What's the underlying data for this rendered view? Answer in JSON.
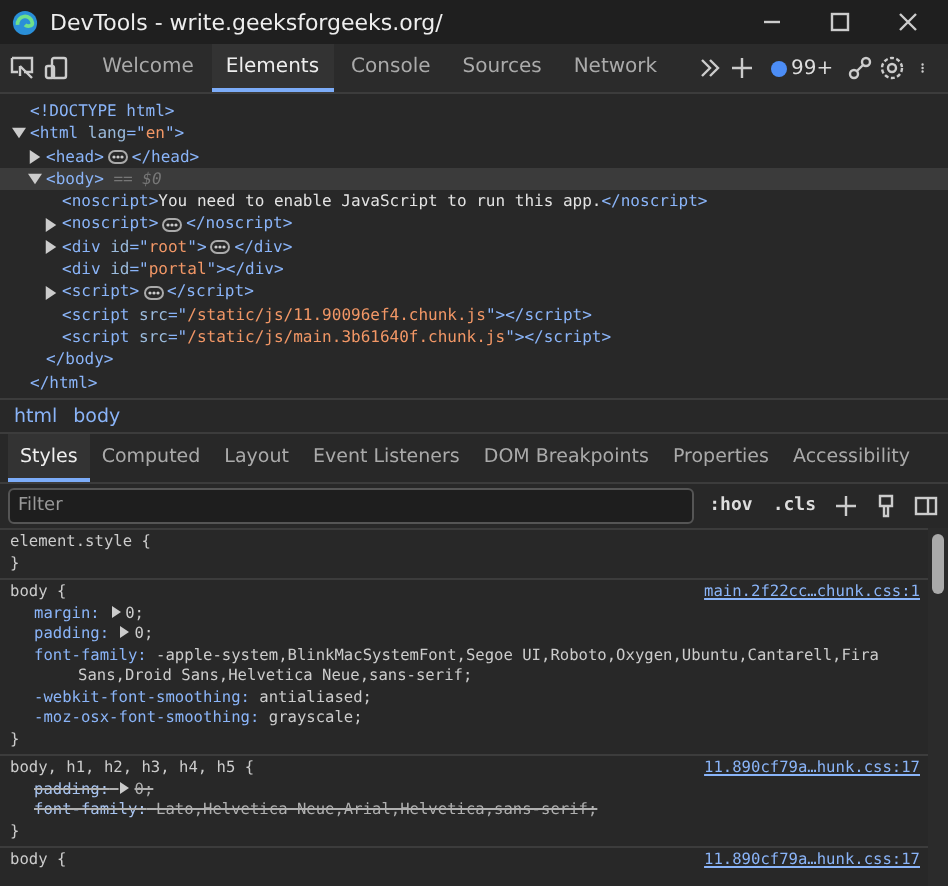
{
  "window": {
    "title": "DevTools - write.geeksforgeeks.org/"
  },
  "toolbar": {
    "tabs": [
      {
        "label": "Welcome",
        "selected": false
      },
      {
        "label": "Elements",
        "selected": true
      },
      {
        "label": "Console",
        "selected": false
      },
      {
        "label": "Sources",
        "selected": false
      },
      {
        "label": "Network",
        "selected": false
      }
    ],
    "issues_badge": "99+"
  },
  "dom_tree": [
    {
      "kind": "leaf",
      "tokens": [
        {
          "kind": "tag",
          "s": "<!DOCTYPE html>"
        }
      ]
    },
    {
      "kind": "open",
      "expanded": true,
      "selected": false,
      "tokens": [
        {
          "kind": "tag",
          "s": "<html"
        },
        {
          "kind": "attr",
          "s": " lang"
        },
        {
          "kind": "tag",
          "s": "=\""
        },
        {
          "kind": "value",
          "s": "en"
        },
        {
          "kind": "tag",
          "s": "\">"
        }
      ],
      "children": [
        {
          "kind": "open",
          "expanded": false,
          "selected": false,
          "tokens": [
            {
              "kind": "tag",
              "s": "<head>"
            }
          ],
          "close": "</head>"
        },
        {
          "kind": "open",
          "expanded": true,
          "selected": true,
          "tokens": [
            {
              "kind": "tag",
              "s": "<body>"
            }
          ],
          "marker": "== $0",
          "children": [
            {
              "kind": "leaf",
              "tokens": [
                {
                  "kind": "tag",
                  "s": "<noscript>"
                },
                {
                  "kind": "text",
                  "s": "You need to enable JavaScript to run this app."
                },
                {
                  "kind": "tag",
                  "s": "</noscript>"
                }
              ]
            },
            {
              "kind": "open",
              "expanded": false,
              "selected": false,
              "tokens": [
                {
                  "kind": "tag",
                  "s": "<noscript>"
                }
              ],
              "close": "</noscript>"
            },
            {
              "kind": "open",
              "expanded": false,
              "selected": false,
              "tokens": [
                {
                  "kind": "tag",
                  "s": "<div"
                },
                {
                  "kind": "attr",
                  "s": " id"
                },
                {
                  "kind": "tag",
                  "s": "=\""
                },
                {
                  "kind": "value",
                  "s": "root"
                },
                {
                  "kind": "tag",
                  "s": "\">"
                }
              ],
              "close": "</div>"
            },
            {
              "kind": "leaf",
              "tokens": [
                {
                  "kind": "tag",
                  "s": "<div"
                },
                {
                  "kind": "attr",
                  "s": " id"
                },
                {
                  "kind": "tag",
                  "s": "=\""
                },
                {
                  "kind": "value",
                  "s": "portal"
                },
                {
                  "kind": "tag",
                  "s": "\"></div>"
                }
              ]
            },
            {
              "kind": "open",
              "expanded": false,
              "selected": false,
              "tokens": [
                {
                  "kind": "tag",
                  "s": "<script>"
                }
              ],
              "close": "</script>"
            },
            {
              "kind": "leaf",
              "tokens": [
                {
                  "kind": "tag",
                  "s": "<script"
                },
                {
                  "kind": "attr",
                  "s": " src"
                },
                {
                  "kind": "tag",
                  "s": "=\""
                },
                {
                  "kind": "value",
                  "s": "/static/js/11.90096ef4.chunk.js"
                },
                {
                  "kind": "tag",
                  "s": "\"></script>"
                }
              ]
            },
            {
              "kind": "leaf",
              "tokens": [
                {
                  "kind": "tag",
                  "s": "<script"
                },
                {
                  "kind": "attr",
                  "s": " src"
                },
                {
                  "kind": "tag",
                  "s": "=\""
                },
                {
                  "kind": "value",
                  "s": "/static/js/main.3b61640f.chunk.js"
                },
                {
                  "kind": "tag",
                  "s": "\"></script>"
                }
              ]
            }
          ],
          "close": "</body>"
        }
      ],
      "close": "</html>"
    }
  ],
  "breadcrumbs": [
    "html",
    "body"
  ],
  "panel_tabs": [
    {
      "label": "Styles",
      "selected": true
    },
    {
      "label": "Computed",
      "selected": false
    },
    {
      "label": "Layout",
      "selected": false
    },
    {
      "label": "Event Listeners",
      "selected": false
    },
    {
      "label": "DOM Breakpoints",
      "selected": false
    },
    {
      "label": "Properties",
      "selected": false
    },
    {
      "label": "Accessibility",
      "selected": false
    }
  ],
  "filter": {
    "placeholder": "Filter",
    "hov": ":hov",
    "cls": ".cls"
  },
  "rules": [
    {
      "selector": "element.style {",
      "close": "}"
    },
    {
      "selector": "body {",
      "source": "main.2f22cc…chunk.css:1",
      "close": "}",
      "declarations": [
        {
          "name": "margin:",
          "value": "0;",
          "expandable": true,
          "struck": false
        },
        {
          "name": "padding:",
          "value": "0;",
          "expandable": true,
          "struck": false
        },
        {
          "name": "font-family:",
          "value": "-apple-system,BlinkMacSystemFont,Segoe UI,Roboto,Oxygen,Ubuntu,Cantarell,Fira Sans,Droid Sans,Helvetica Neue,sans-serif;",
          "expandable": false,
          "struck": false
        },
        {
          "name": "-webkit-font-smoothing:",
          "value": "antialiased;",
          "expandable": false,
          "struck": false
        },
        {
          "name": "-moz-osx-font-smoothing:",
          "value": "grayscale;",
          "expandable": false,
          "struck": false
        }
      ]
    },
    {
      "selector": "body, h1, h2, h3, h4, h5 {",
      "source": "11.890cf79a…hunk.css:17",
      "close": "}",
      "declarations": [
        {
          "name": "padding:",
          "value": "0;",
          "expandable": true,
          "struck": true
        },
        {
          "name": "font-family:",
          "value": "Lato,Helvetica Neue,Arial,Helvetica,sans-serif;",
          "expandable": false,
          "struck": true
        }
      ]
    },
    {
      "selector": "body {",
      "source": "11.890cf79a…hunk.css:17"
    }
  ]
}
